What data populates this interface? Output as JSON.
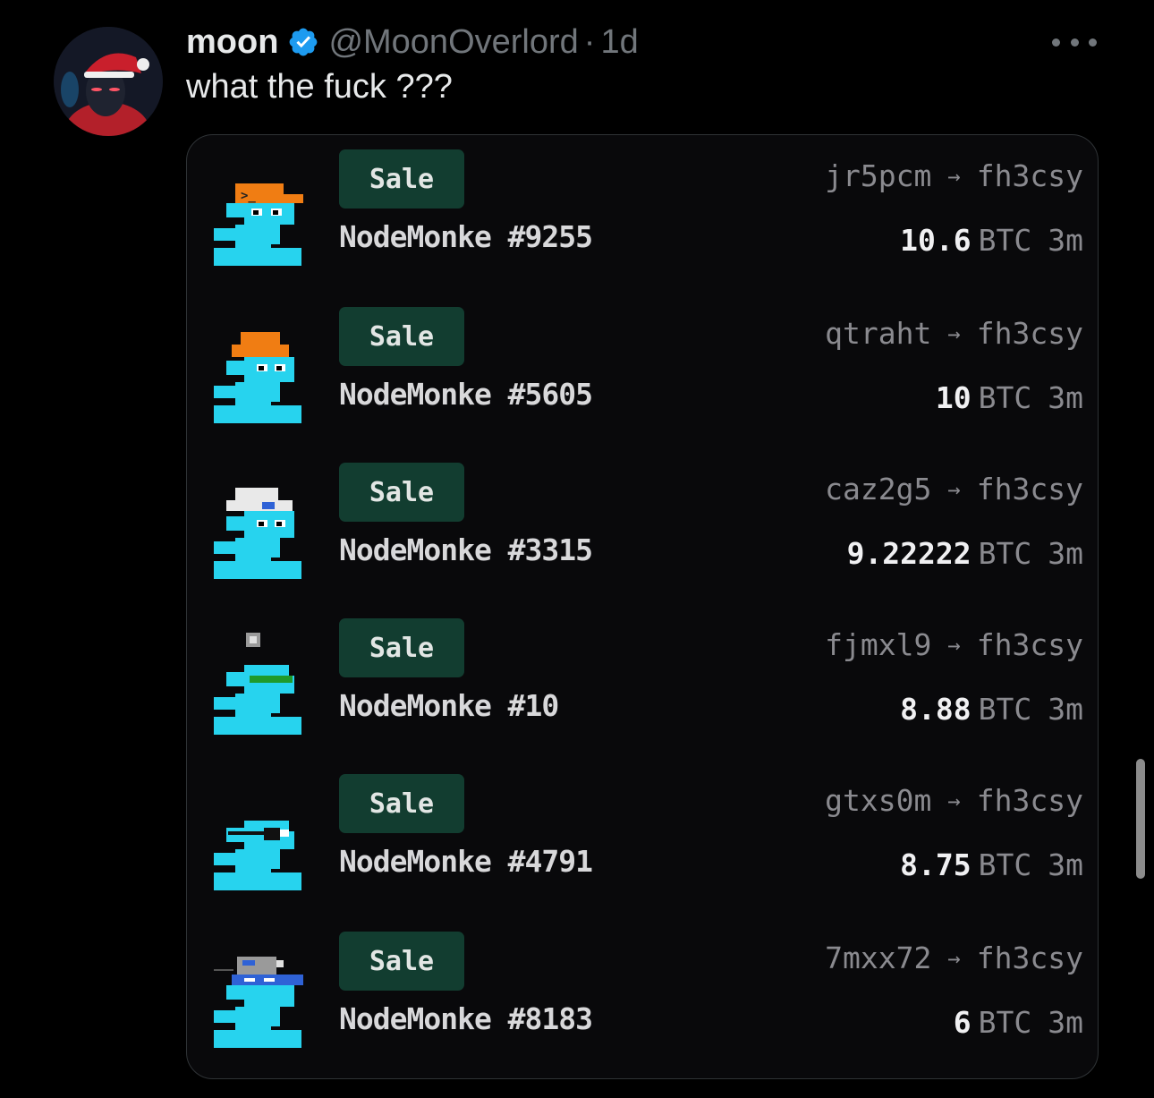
{
  "tweet": {
    "author_name": "moon",
    "handle": "@MoonOverlord",
    "separator": "·",
    "time": "1d",
    "text": "what the fuck ???"
  },
  "colors": {
    "background": "#000000",
    "verified_blue": "#1d9bf0",
    "badge_green": "#123d30",
    "monke_cyan": "#27d3ee"
  },
  "sales": [
    {
      "badge": "Sale",
      "name": "NodeMonke #9255",
      "from": "jr5pcm",
      "arrow": "→",
      "to": "fh3csy",
      "amount": "10.6",
      "currency": "BTC",
      "ago": "3m",
      "accessory": "terminal-cap-icon"
    },
    {
      "badge": "Sale",
      "name": "NodeMonke #5605",
      "from": "qtraht",
      "arrow": "→",
      "to": "fh3csy",
      "amount": "10",
      "currency": "BTC",
      "ago": "3m",
      "accessory": "orange-beanie-icon"
    },
    {
      "badge": "Sale",
      "name": "NodeMonke #3315",
      "from": "caz2g5",
      "arrow": "→",
      "to": "fh3csy",
      "amount": "9.22222",
      "currency": "BTC",
      "ago": "3m",
      "accessory": "white-cap-icon"
    },
    {
      "badge": "Sale",
      "name": "NodeMonke #10",
      "from": "fjmxl9",
      "arrow": "→",
      "to": "fh3csy",
      "amount": "8.88",
      "currency": "BTC",
      "ago": "3m",
      "accessory": "green-shades-icon"
    },
    {
      "badge": "Sale",
      "name": "NodeMonke #4791",
      "from": "gtxs0m",
      "arrow": "→",
      "to": "fh3csy",
      "amount": "8.75",
      "currency": "BTC",
      "ago": "3m",
      "accessory": "eyepatch-icon"
    },
    {
      "badge": "Sale",
      "name": "NodeMonke #8183",
      "from": "7mxx72",
      "arrow": "→",
      "to": "fh3csy",
      "amount": "6",
      "currency": "BTC",
      "ago": "3m",
      "accessory": "blue-visor-icon"
    }
  ]
}
